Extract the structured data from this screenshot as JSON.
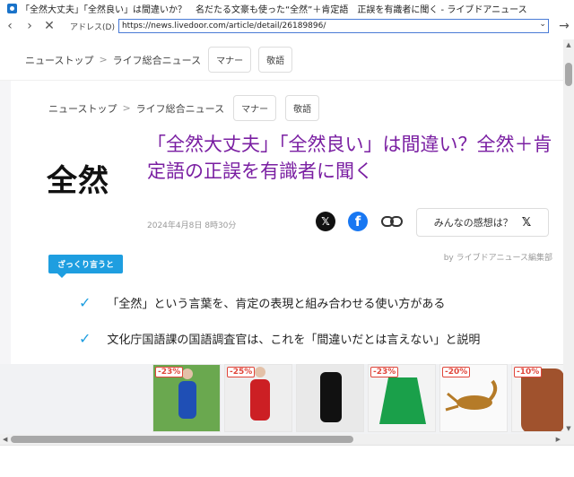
{
  "window": {
    "title": "「全然大丈夫」「全然良い」は間違いか？　名だたる文豪も使った“全然”＋肯定語　正誤を有識者に聞く - ライブドアニュース"
  },
  "addressbar": {
    "back_icon": "chevron-left-icon",
    "forward_icon": "chevron-right-icon",
    "stop_icon": "close-icon",
    "label": "アドレス(D)",
    "url": "https://news.livedoor.com/article/detail/26189896/",
    "go_icon": "arrow-right-icon"
  },
  "nav": {
    "crumb_home": "ニューストップ",
    "crumb_sep": ">",
    "crumb_category": "ライフ総合ニュース",
    "tag1": "マナー",
    "tag2": "敬語"
  },
  "article": {
    "logo": "全然",
    "headline": "「全然大丈夫」「全然良い」は間違い？全然＋肯定語の正誤を有識者に聞く",
    "date": "2024年4月8日 8時30分",
    "share_x": "𝕏",
    "share_fb": "f",
    "feeling_label": "みんなの感想は？",
    "feeling_icon": "𝕏",
    "byline": "by ライブドアニュース編集部",
    "summary_badge": "ざっくり言うと",
    "points": [
      "「全然」という言葉を、肯定の表現と組み合わせる使い方がある",
      "文化庁国語課の国語調査官は、これを「間違いだとは言えない」と説明"
    ]
  },
  "ads": [
    {
      "discount": "-23%",
      "color": "#6aa84f",
      "item_color": "#1f4fb5"
    },
    {
      "discount": "-25%",
      "color": "#eeeeee",
      "item_color": "#cc1f24"
    },
    {
      "discount": "",
      "color": "#e9e9e9",
      "item_color": "#111111"
    },
    {
      "discount": "-23%",
      "color": "#f3f3f3",
      "item_color": "#1aa04a"
    },
    {
      "discount": "-20%",
      "color": "#fafafa",
      "item_color": "#b57b28"
    },
    {
      "discount": "-10%",
      "color": "#f4f4f4",
      "item_color": "#a0522d"
    }
  ],
  "colors": {
    "headline": "#7a1fa2",
    "accent": "#1e9ee0"
  }
}
